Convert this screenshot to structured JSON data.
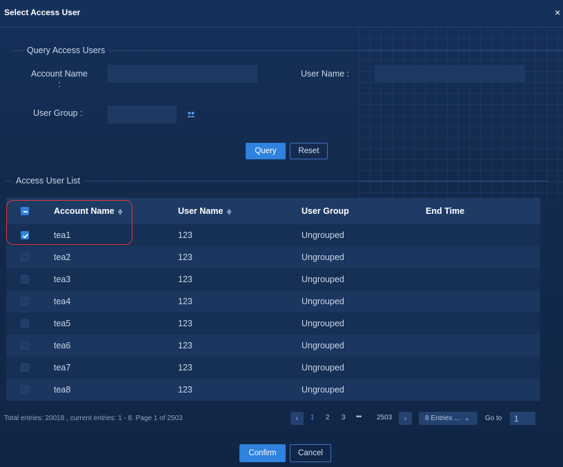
{
  "dialog": {
    "title": "Select Access User",
    "close_glyph": "×"
  },
  "query": {
    "legend": "Query Access Users",
    "account_name_label_line1": "Account Name",
    "account_name_label_line2": ":",
    "account_name_value": "",
    "user_name_label": "User Name :",
    "user_name_value": "",
    "user_group_label": "User Group :",
    "user_group_value": "",
    "user_group_icon": "user-group-icon",
    "query_button": "Query",
    "reset_button": "Reset"
  },
  "list": {
    "legend": "Access User List",
    "columns": {
      "account_name": "Account Name",
      "user_name": "User Name",
      "user_group": "User Group",
      "end_time": "End Time",
      "sort_glyph": "≑"
    },
    "rows": [
      {
        "account": "tea1",
        "user": "123",
        "group": "Ungrouped",
        "end": "",
        "checked": true
      },
      {
        "account": "tea2",
        "user": "123",
        "group": "Ungrouped",
        "end": "",
        "checked": false
      },
      {
        "account": "tea3",
        "user": "123",
        "group": "Ungrouped",
        "end": "",
        "checked": false
      },
      {
        "account": "tea4",
        "user": "123",
        "group": "Ungrouped",
        "end": "",
        "checked": false
      },
      {
        "account": "tea5",
        "user": "123",
        "group": "Ungrouped",
        "end": "",
        "checked": false
      },
      {
        "account": "tea6",
        "user": "123",
        "group": "Ungrouped",
        "end": "",
        "checked": false
      },
      {
        "account": "tea7",
        "user": "123",
        "group": "Ungrouped",
        "end": "",
        "checked": false
      },
      {
        "account": "tea8",
        "user": "123",
        "group": "Ungrouped",
        "end": "",
        "checked": false
      }
    ]
  },
  "pagination": {
    "summary": "Total entries: 20018 , current entries: 1 - 8. Page 1 of 2503",
    "prev_glyph": "‹",
    "next_glyph": "›",
    "pages": [
      "1",
      "2",
      "3"
    ],
    "ellipsis": "•••",
    "last_page": "2503",
    "entries_select": "8 Entries ...",
    "entries_chevron": "⌄",
    "goto_label": "Go to",
    "goto_value": "1"
  },
  "actions": {
    "confirm": "Confirm",
    "cancel": "Cancel"
  },
  "colors": {
    "primary": "#2f82de",
    "background": "#13284a",
    "highlight": "#e0383e"
  }
}
